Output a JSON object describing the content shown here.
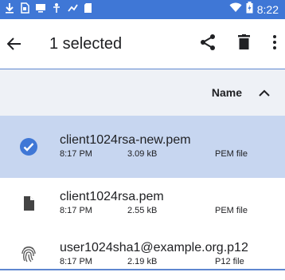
{
  "status_bar": {
    "time": "8:22",
    "icons": [
      "download-icon",
      "sim-icon",
      "screen-cast-icon",
      "accessibility-icon",
      "signal-icon",
      "sd-card-icon",
      "wifi-icon",
      "battery-icon"
    ],
    "color": "#3f77d6"
  },
  "toolbar": {
    "title": "1 selected",
    "back_icon": "arrow-back-icon",
    "actions": [
      "share-icon",
      "delete-icon",
      "more-vert-icon"
    ]
  },
  "list_header": {
    "sort_label": "Name",
    "sort_icon": "chevron-up-icon"
  },
  "files": [
    {
      "name": "client1024rsa-new.pem",
      "time": "8:17 PM",
      "size": "3.09 kB",
      "type": "PEM file",
      "icon": "check-circle-icon",
      "selected": true
    },
    {
      "name": "client1024rsa.pem",
      "time": "8:17 PM",
      "size": "2.55 kB",
      "type": "PEM file",
      "icon": "file-icon",
      "selected": false
    },
    {
      "name": "user1024sha1@example.org.p12",
      "time": "8:17 PM",
      "size": "2.19 kB",
      "type": "P12 file",
      "icon": "fingerprint-icon",
      "selected": false
    }
  ],
  "colors": {
    "accent": "#3f77d6",
    "selected_row": "#c7d6f0",
    "header_bg": "#eef1f6"
  }
}
